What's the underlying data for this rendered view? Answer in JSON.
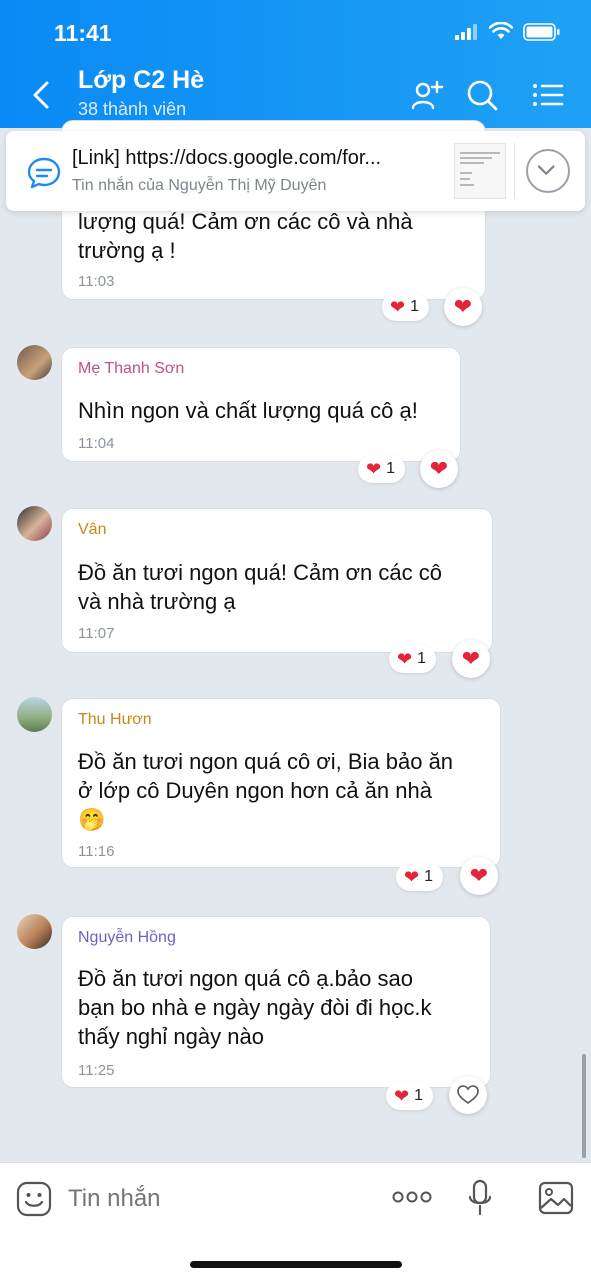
{
  "status": {
    "time": "11:41"
  },
  "header": {
    "title": "Lớp C2 Hè",
    "subtitle": "38 thành viên"
  },
  "pinned": {
    "title": "[Link] https://docs.google.com/for...",
    "subtitle": "Tin nhắn của Nguyễn Thị Mỹ Duyên"
  },
  "messages": [
    {
      "text_lines": [
        "lượng quá! Cảm ơn các cô và nhà",
        "trường ạ !"
      ],
      "time": "11:03",
      "reaction_count": "1"
    },
    {
      "sender": "Mẹ Thanh Sơn",
      "sender_color": "#c0518c",
      "text_lines": [
        "Nhìn ngon và chất lượng quá cô ạ!"
      ],
      "time": "11:04",
      "reaction_count": "1"
    },
    {
      "sender": "Vân",
      "sender_color": "#c6871b",
      "text_lines": [
        "Đồ ăn tươi ngon quá! Cảm ơn các cô",
        "và nhà trường ạ"
      ],
      "time": "11:07",
      "reaction_count": "1"
    },
    {
      "sender": "Thu Hươn",
      "sender_color": "#c6871b",
      "text_lines": [
        "Đồ ăn tươi ngon quá cô ơi, Bia bảo ăn",
        "ở lớp cô Duyên ngon hơn cả ăn nhà",
        "🤭"
      ],
      "time": "11:16",
      "reaction_count": "1"
    },
    {
      "sender": "Nguyễn Hồng",
      "sender_color": "#6a63c6",
      "text_lines": [
        "Đồ ăn tươi ngon quá cô ạ.bảo sao",
        "bạn bo nhà e ngày ngày đòi đi học.k",
        "thấy nghỉ ngày nào"
      ],
      "time": "11:25",
      "reaction_count": "1"
    }
  ],
  "composer": {
    "placeholder": "Tin nhắn"
  },
  "colors": {
    "accent": "#0a8af5",
    "heart": "#e3243b"
  },
  "icons": [
    "back-arrow-icon",
    "add-member-icon",
    "search-icon",
    "menu-icon",
    "chat-bubble-icon",
    "chevron-down-icon",
    "heart-icon",
    "sticker-icon",
    "more-dots-icon",
    "microphone-icon",
    "image-icon"
  ]
}
